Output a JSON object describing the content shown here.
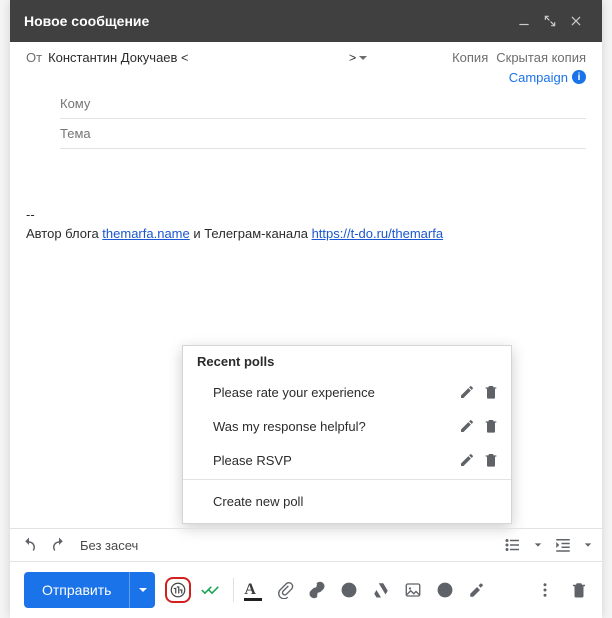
{
  "titlebar": {
    "title": "Новое сообщение"
  },
  "from_label": "От",
  "sender_name": "Константин Докучаев <",
  "sender_closing": ">",
  "cc_label": "Копия",
  "bcc_label": "Скрытая копия",
  "campaign_label": "Campaign",
  "to_placeholder": "Кому",
  "subject_placeholder": "Тема",
  "body": {
    "sig_sep": "--",
    "text1": "Автор блога ",
    "link1": "themarfa.name",
    "text2": " и Телеграм-канала ",
    "link2": "https://t-do.ru/themarfa"
  },
  "fontname": "Без засеч",
  "send_label": "Отправить",
  "popup": {
    "header": "Recent polls",
    "items": [
      "Please rate your experience",
      "Was my response helpful?",
      "Please RSVP"
    ],
    "create": "Create new poll"
  }
}
